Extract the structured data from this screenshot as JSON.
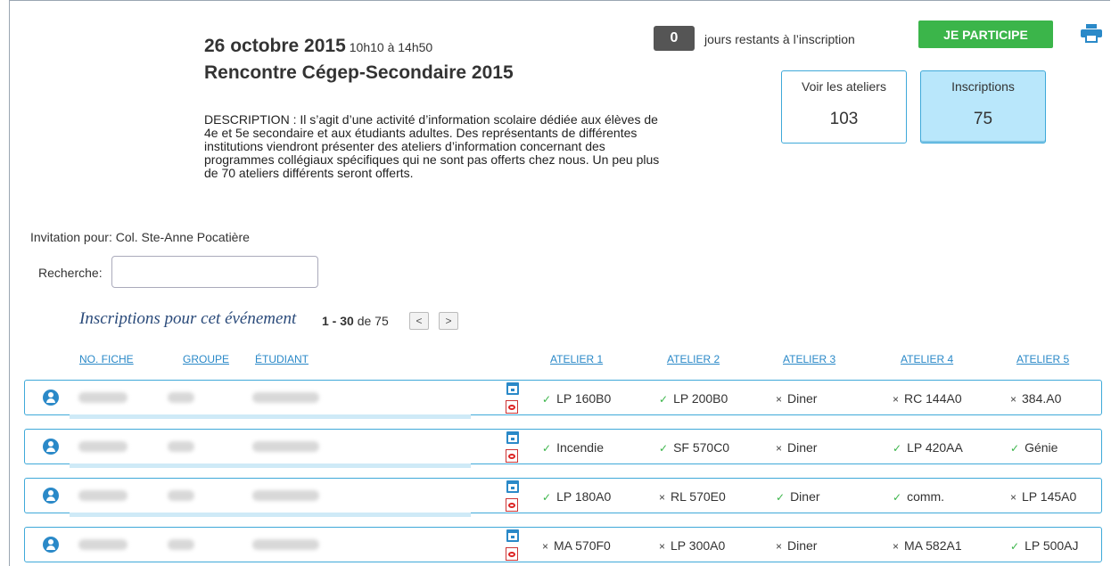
{
  "event": {
    "date": "26 octobre 2015",
    "time": "10h10 à 14h50",
    "title": "Rencontre Cégep-Secondaire 2015",
    "description": "DESCRIPTION : Il s’agit d’une activité d’information scolaire dédiée aux élèves de 4e et 5e secondaire et aux étudiants adultes. Des représentants de différentes institutions viendront présenter des ateliers d’information concernant des programmes collégiaux spécifiques qui ne sont pas offerts chez nous. Un peu plus de 70 ateliers différents seront offerts."
  },
  "countdown": {
    "days": "0",
    "label": "jours restants à l’inscription"
  },
  "participate_label": "JE PARTICIPE",
  "stats": {
    "ateliers": {
      "label": "Voir les ateliers",
      "value": "103"
    },
    "inscriptions": {
      "label": "Inscriptions",
      "value": "75"
    }
  },
  "invitation": "Invitation pour: Col. Ste-Anne Pocatière",
  "search": {
    "label": "Recherche:",
    "value": ""
  },
  "list": {
    "title": "Inscriptions pour cet événement",
    "range": "1 - 30",
    "of": "de",
    "total": "75",
    "prev": "<",
    "next": ">"
  },
  "columns": {
    "fiche": "NO. FICHE",
    "groupe": "GROUPE",
    "etudiant": "ÉTUDIANT",
    "a1": "ATELIER 1",
    "a2": "ATELIER 2",
    "a3": "ATELIER 3",
    "a4": "ATELIER 4",
    "a5": "ATELIER 5"
  },
  "rows": [
    {
      "ateliers": [
        {
          "t": "LP 160B0",
          "ok": true
        },
        {
          "t": "LP 200B0",
          "ok": true
        },
        {
          "t": "Diner",
          "ok": false
        },
        {
          "t": "RC 144A0",
          "ok": false
        },
        {
          "t": "384.A0",
          "ok": false
        }
      ]
    },
    {
      "ateliers": [
        {
          "t": "Incendie",
          "ok": true
        },
        {
          "t": "SF 570C0",
          "ok": true
        },
        {
          "t": "Diner",
          "ok": false
        },
        {
          "t": "LP 420AA",
          "ok": true
        },
        {
          "t": "Génie",
          "ok": true
        }
      ]
    },
    {
      "ateliers": [
        {
          "t": "LP 180A0",
          "ok": true
        },
        {
          "t": "RL 570E0",
          "ok": false
        },
        {
          "t": "Diner",
          "ok": true
        },
        {
          "t": "comm.",
          "ok": true
        },
        {
          "t": "LP 145A0",
          "ok": false
        }
      ]
    },
    {
      "ateliers": [
        {
          "t": "MA 570F0",
          "ok": false
        },
        {
          "t": "LP 300A0",
          "ok": false
        },
        {
          "t": "Diner",
          "ok": false
        },
        {
          "t": "MA 582A1",
          "ok": false
        },
        {
          "t": "LP 500AJ",
          "ok": true
        }
      ]
    }
  ],
  "icons": {
    "ok": "✓",
    "no": "×"
  }
}
